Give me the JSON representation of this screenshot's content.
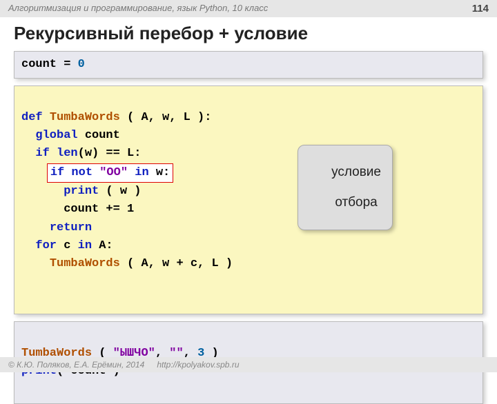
{
  "header": {
    "course": "Алгоритмизация и программирование, язык Python, 10 класс",
    "page": "114"
  },
  "title": "Рекурсивный перебор + условие",
  "code1": {
    "l1a": "count = ",
    "l1b": "0"
  },
  "code2": {
    "l1a": "def ",
    "l1b": "TumbaWords",
    "l1c": " ( A, w, L ):",
    "l2a": "  ",
    "l2b": "global",
    "l2c": " count",
    "l3a": "  ",
    "l3b": "if len",
    "l3c": "(w) == L:",
    "l4a": "    ",
    "l4b": "if not ",
    "l4c": "\"OO\"",
    "l4d": " in",
    "l4e": " w:",
    "l5a": "      ",
    "l5b": "print",
    "l5c": " ( w )",
    "l6": "      count += 1",
    "l7a": "    ",
    "l7b": "return",
    "l8a": "  ",
    "l8b": "for",
    "l8c": " c ",
    "l8d": "in",
    "l8e": " A:",
    "l9a": "    ",
    "l9b": "TumbaWords",
    "l9c": " ( A, w + c, L )"
  },
  "callout": {
    "line1": "условие",
    "line2": "отбора"
  },
  "code3": {
    "l1a": "TumbaWords",
    "l1b": " ( ",
    "l1c": "\"ЫШЧО\"",
    "l1d": ", ",
    "l1e": "\"\"",
    "l1f": ", ",
    "l1g": "3",
    "l1h": " )",
    "l2a": "print",
    "l2b": "( count )"
  },
  "footer": {
    "copyright": "© К.Ю. Поляков, Е.А. Ерёмин, 2014",
    "url": "http://kpolyakov.spb.ru"
  }
}
